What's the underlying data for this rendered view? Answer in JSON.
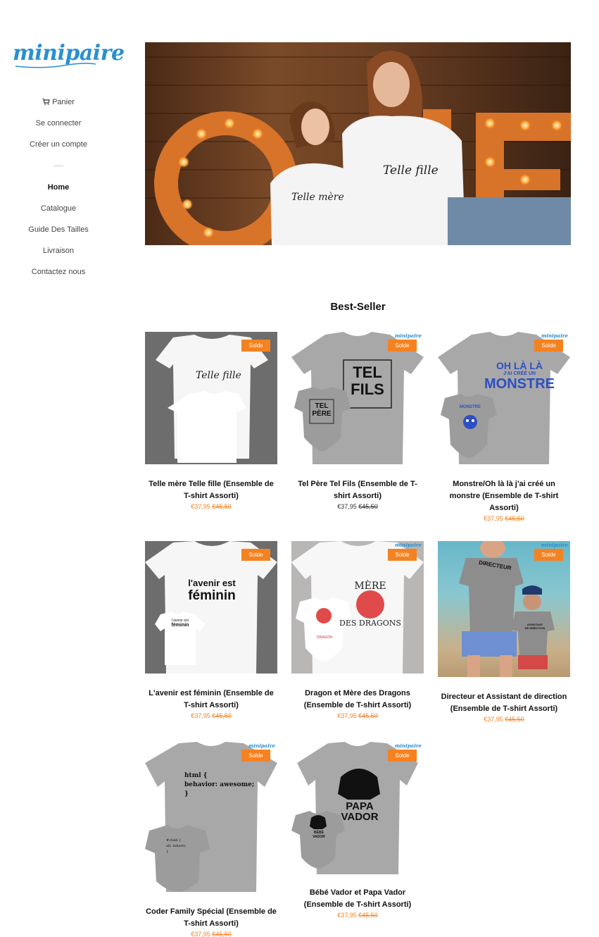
{
  "brand": {
    "logo_text": "minipaire"
  },
  "sidebar": {
    "account": [
      {
        "label": "Panier",
        "icon": "cart-icon"
      },
      {
        "label": "Se connecter"
      },
      {
        "label": "Créer un compte"
      }
    ],
    "nav": [
      {
        "label": "Home",
        "active": true
      },
      {
        "label": "Catalogue"
      },
      {
        "label": "Guide Des Tailles"
      },
      {
        "label": "Livraison"
      },
      {
        "label": "Contactez nous"
      }
    ]
  },
  "hero": {
    "shirt_text_adult": "Telle fille",
    "shirt_text_child": "Telle mère"
  },
  "section": {
    "title": "Best-Seller"
  },
  "products": [
    {
      "title_line1": "Telle mère Telle fille (Ensemble de",
      "title_line2": "T-shirt Assorti)",
      "price": "€37,95",
      "old_price": "€45,50",
      "badge": "Solde",
      "shirt_text": "Telle fille"
    },
    {
      "title_line1": "Tel Père Tel Fils (Ensemble de T-",
      "title_line2": "shirt Assorti)",
      "price": "€37,95",
      "old_price": "€45,50",
      "badge": "Solde",
      "shirt_text": "TEL FILS",
      "body_text": "TEL PÈRE",
      "mini_logo": "minipaire"
    },
    {
      "title_line1": "Monstre/Oh là là j'ai créé un",
      "title_line2": "monstre (Ensemble de T-shirt",
      "title_line3": "Assorti)",
      "price": "€37,95",
      "old_price": "€45,50",
      "badge": "Solde",
      "shirt_text1": "OH LÀ LÀ",
      "shirt_text2": "J'AI CRÉÉ UN",
      "shirt_text3": "MONSTRE",
      "body_text": "MONSTRE",
      "mini_logo": "minipaire"
    },
    {
      "title_line1": "L'avenir est féminin (Ensemble de",
      "title_line2": "T-shirt Assorti)",
      "price": "€37,95",
      "old_price": "€45,50",
      "badge": "Solde",
      "shirt_text1": "l'avenir est",
      "shirt_text2": "féminin",
      "kid_text1": "l'avenir est",
      "kid_text2": "féminin"
    },
    {
      "title_line1": "Dragon et Mère des Dragons",
      "title_line2": "(Ensemble de T-shirt Assorti)",
      "price": "€37,95",
      "old_price": "€45,50",
      "badge": "Solde",
      "shirt_text1": "MÈRE",
      "shirt_text2": "DES DRAGONS",
      "body_text": "DRAGON",
      "mini_logo": "minipaire"
    },
    {
      "title_line1": "Directeur et Assistant de direction",
      "title_line2": "(Ensemble de T-shirt Assorti)",
      "price": "€37,95",
      "old_price": "€45,50",
      "badge": "Solde",
      "shirt_text": "DIRECTEUR",
      "kid_text1": "ASSISTANT",
      "kid_text2": "DE DIRECTION",
      "mini_logo": "minipaire"
    },
    {
      "title_line1": "Coder Family Spécial (Ensemble de",
      "title_line2": "T-shirt Assorti)",
      "price": "€37,95",
      "old_price": "€45,50",
      "badge": "Solde",
      "code1": "html {",
      "code2": "behavior: awesome;",
      "code3": "}",
      "kid1": "#child {",
      "kid2": "all: inherit;",
      "kid3": "}",
      "mini_logo": "minipaire"
    },
    {
      "title_line1": "Bébé Vador et Papa Vador",
      "title_line2": "(Ensemble de T-shirt Assorti)",
      "price": "€37,95",
      "old_price": "€45,50",
      "badge": "Solde",
      "shirt_text1": "PAPA",
      "shirt_text2": "VADOR",
      "body_text1": "BÉBÉ",
      "body_text2": "VADOR",
      "mini_logo": "minipaire"
    }
  ]
}
